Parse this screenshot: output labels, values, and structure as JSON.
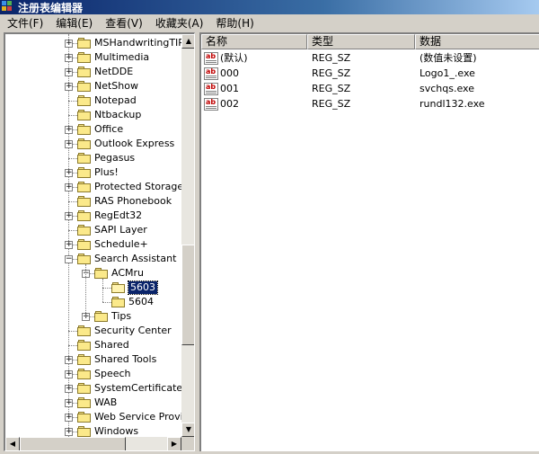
{
  "window": {
    "title": "注册表编辑器"
  },
  "menu": [
    "文件(F)",
    "编辑(E)",
    "查看(V)",
    "收藏夹(A)",
    "帮助(H)"
  ],
  "tree": {
    "items": [
      {
        "label": "MSHandwritingTIP",
        "level": 0,
        "expander": "+"
      },
      {
        "label": "Multimedia",
        "level": 0,
        "expander": "+"
      },
      {
        "label": "NetDDE",
        "level": 0,
        "expander": "+"
      },
      {
        "label": "NetShow",
        "level": 0,
        "expander": "+"
      },
      {
        "label": "Notepad",
        "level": 0,
        "expander": ""
      },
      {
        "label": "Ntbackup",
        "level": 0,
        "expander": ""
      },
      {
        "label": "Office",
        "level": 0,
        "expander": "+"
      },
      {
        "label": "Outlook Express",
        "level": 0,
        "expander": "+"
      },
      {
        "label": "Pegasus",
        "level": 0,
        "expander": ""
      },
      {
        "label": "Plus!",
        "level": 0,
        "expander": "+"
      },
      {
        "label": "Protected Storage",
        "level": 0,
        "expander": "+"
      },
      {
        "label": "RAS Phonebook",
        "level": 0,
        "expander": ""
      },
      {
        "label": "RegEdt32",
        "level": 0,
        "expander": "+"
      },
      {
        "label": "SAPI Layer",
        "level": 0,
        "expander": ""
      },
      {
        "label": "Schedule+",
        "level": 0,
        "expander": "+"
      },
      {
        "label": "Search Assistant",
        "level": 0,
        "expander": "-"
      },
      {
        "label": "ACMru",
        "level": 1,
        "expander": "-"
      },
      {
        "label": "5603",
        "level": 2,
        "expander": "",
        "selected": true,
        "open": true
      },
      {
        "label": "5604",
        "level": 2,
        "expander": ""
      },
      {
        "label": "Tips",
        "level": 1,
        "expander": "+"
      },
      {
        "label": "Security Center",
        "level": 0,
        "expander": ""
      },
      {
        "label": "Shared",
        "level": 0,
        "expander": ""
      },
      {
        "label": "Shared Tools",
        "level": 0,
        "expander": "+"
      },
      {
        "label": "Speech",
        "level": 0,
        "expander": "+"
      },
      {
        "label": "SystemCertificates",
        "level": 0,
        "expander": "+"
      },
      {
        "label": "WAB",
        "level": 0,
        "expander": "+"
      },
      {
        "label": "Web Service Providers",
        "level": 0,
        "expander": "+"
      },
      {
        "label": "Windows",
        "level": 0,
        "expander": "+"
      }
    ]
  },
  "list": {
    "columns": [
      "名称",
      "类型",
      "数据"
    ],
    "rows": [
      {
        "name": "(默认)",
        "type": "REG_SZ",
        "data": "(数值未设置)"
      },
      {
        "name": "000",
        "type": "REG_SZ",
        "data": "Logo1_.exe"
      },
      {
        "name": "001",
        "type": "REG_SZ",
        "data": "svchqs.exe"
      },
      {
        "name": "002",
        "type": "REG_SZ",
        "data": "rundl132.exe"
      }
    ]
  },
  "icons": {
    "value_icon_text": "ab"
  },
  "colors": {
    "title_bar": "#0a246a",
    "selection": "#0a246a",
    "folder": "#fbe98a"
  }
}
